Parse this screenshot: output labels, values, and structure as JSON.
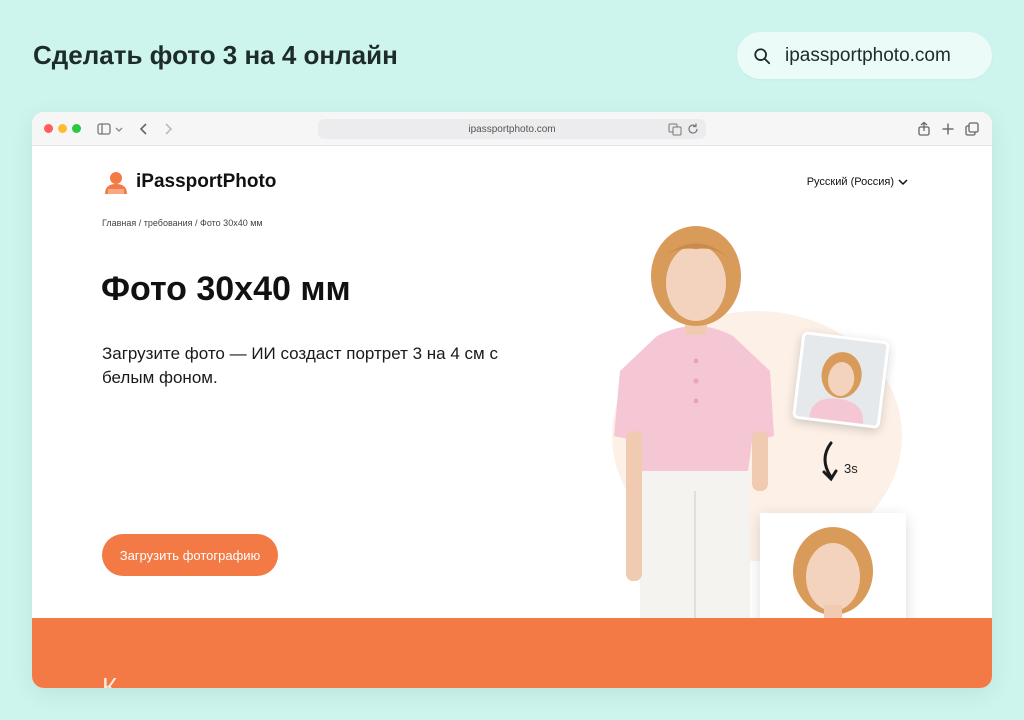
{
  "page": {
    "title": "Сделать фото 3 на 4 онлайн",
    "url_pill": "ipassportphoto.com"
  },
  "browser": {
    "address": "ipassportphoto.com"
  },
  "site": {
    "logo_text": "iPassportPhoto",
    "language": "Русский (Россия)",
    "breadcrumb": "Главная / требования / Фото 30x40 мм",
    "hero_title": "Фото 30x40 мм",
    "hero_desc": "Загрузите фото — ИИ создаст портрет 3 на 4 см с белым фоном.",
    "upload_button": "Загрузить фотографию",
    "time_label": "3s",
    "band_text": "К"
  },
  "colors": {
    "accent": "#f47a45",
    "page_bg": "#cdf5ee"
  }
}
